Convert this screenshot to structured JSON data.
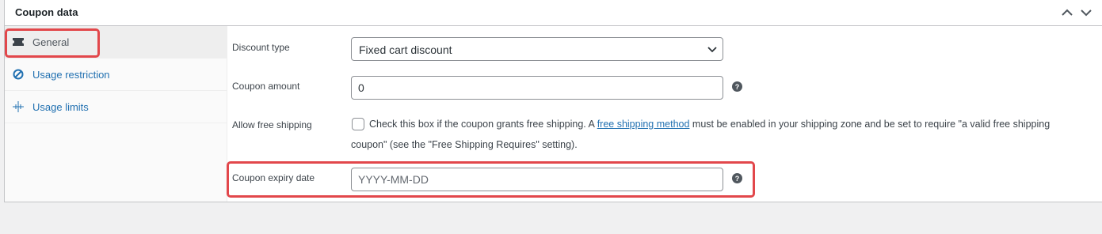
{
  "panel": {
    "title": "Coupon data",
    "collapse_icon": "chevron-up-icon",
    "expand_icon": "chevron-down-icon"
  },
  "tabs": [
    {
      "label": "General",
      "icon": "ticket-icon",
      "active": true
    },
    {
      "label": "Usage restriction",
      "icon": "prohibited-icon",
      "active": false
    },
    {
      "label": "Usage limits",
      "icon": "crosshair-icon",
      "active": false
    }
  ],
  "fields": {
    "discount_type": {
      "label": "Discount type",
      "value": "Fixed cart discount"
    },
    "coupon_amount": {
      "label": "Coupon amount",
      "value": "0"
    },
    "free_shipping": {
      "label": "Allow free shipping",
      "checked": false,
      "desc_before": "Check this box if the coupon grants free shipping. A ",
      "link": "free shipping method",
      "desc_after": " must be enabled in your shipping zone and be set to require \"a valid free shipping",
      "desc_line2": "coupon\" (see the \"Free Shipping Requires\" setting)."
    },
    "expiry_date": {
      "label": "Coupon expiry date",
      "value": "",
      "placeholder": "YYYY-MM-DD"
    }
  },
  "colors": {
    "highlight": "#e2474b",
    "link": "#2271b1",
    "border": "#c3c4c7"
  }
}
